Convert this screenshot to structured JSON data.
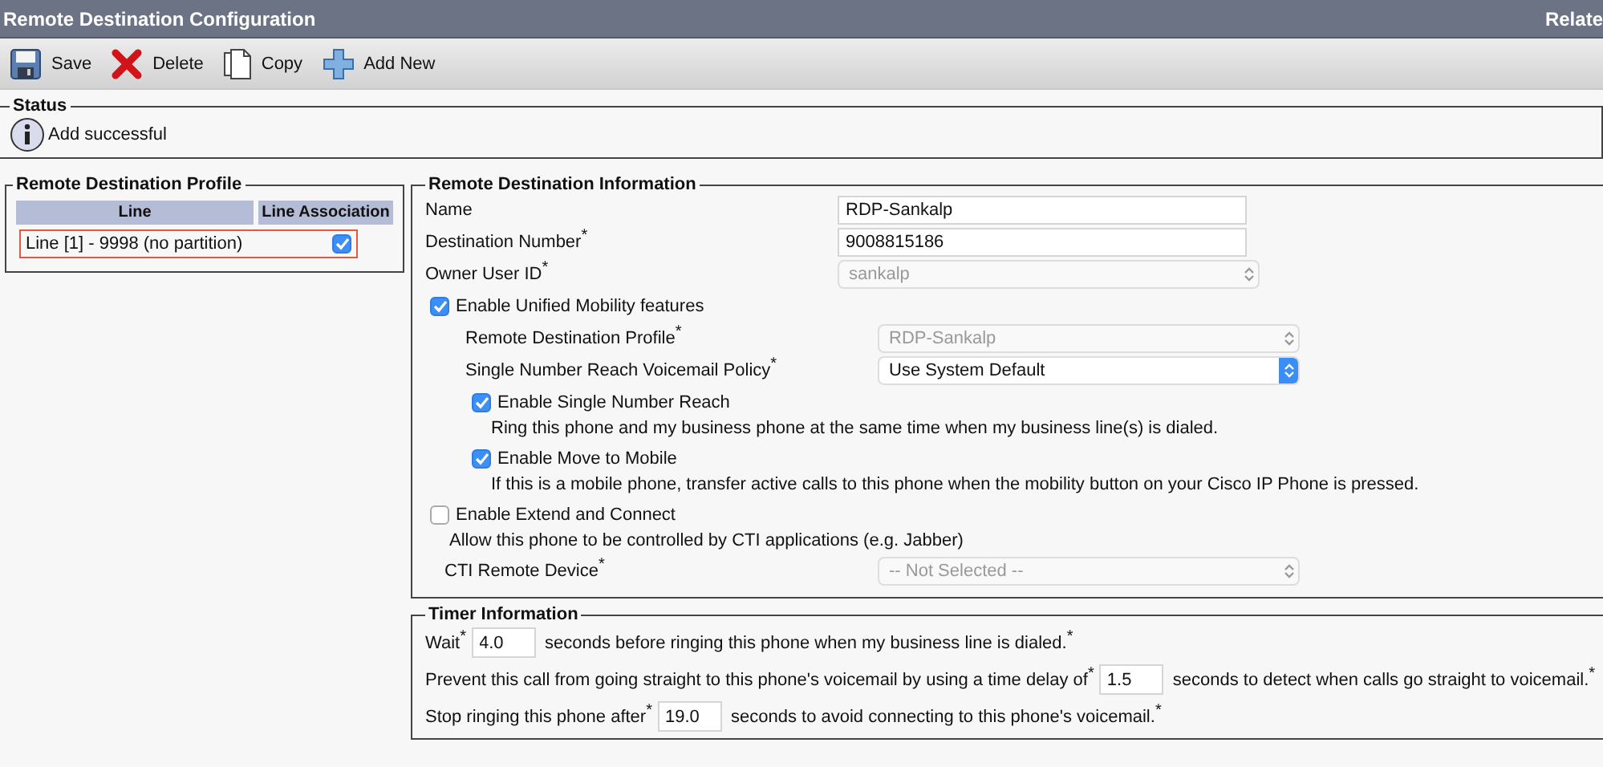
{
  "header": {
    "title": "Remote Destination Configuration",
    "related": "Relate"
  },
  "toolbar": [
    {
      "kind": "save",
      "label": "Save"
    },
    {
      "kind": "delete",
      "label": "Delete"
    },
    {
      "kind": "copy",
      "label": "Copy"
    },
    {
      "kind": "add",
      "label": "Add New"
    }
  ],
  "status": {
    "legend": "Status",
    "message": "Add successful"
  },
  "profile": {
    "legend": "Remote Destination Profile",
    "columns": [
      "Line",
      "Line Association"
    ],
    "rows": [
      {
        "line": "Line [1] - 9998 (no partition)",
        "checked": true,
        "highlighted": true
      }
    ]
  },
  "info": {
    "legend": "Remote Destination Information",
    "fields": [
      {
        "kind": "text",
        "label": "Name",
        "value": "RDP-Sankalp"
      },
      {
        "kind": "text",
        "label": "Destination Number",
        "mark": "*",
        "value": "9008815186"
      },
      {
        "kind": "select",
        "label": "Owner User ID",
        "mark": "*",
        "value": "sankalp",
        "disabled": true
      }
    ],
    "mobility": {
      "label": "Enable Unified Mobility features",
      "checked": true,
      "fields": [
        {
          "kind": "select",
          "label": "Remote Destination Profile",
          "mark": "*",
          "value": "RDP-Sankalp",
          "disabled": true
        },
        {
          "kind": "select",
          "label": "Single Number Reach Voicemail Policy",
          "mark": "*",
          "value": "Use System Default",
          "disabled": false
        }
      ],
      "options": [
        {
          "label": "Enable Single Number Reach",
          "checked": true,
          "description": "Ring this phone and my business phone at the same time when my business line(s) is dialed."
        },
        {
          "label": "Enable Move to Mobile",
          "checked": true,
          "description": "If this is a mobile phone, transfer active calls to this phone when the mobility button on your Cisco IP Phone is pressed."
        }
      ]
    },
    "extend": {
      "label": "Enable Extend and Connect",
      "checked": false,
      "description": "Allow this phone to be controlled by CTI applications (e.g. Jabber)",
      "field": {
        "kind": "select",
        "label": "CTI Remote Device",
        "mark": "*",
        "value": "-- Not Selected --",
        "disabled": true
      }
    }
  },
  "timer": {
    "legend": "Timer Information",
    "rows": [
      {
        "before": "Wait",
        "before_mark": "*",
        "value": "4.0",
        "after": "seconds before ringing this phone when my business line is dialed.",
        "after_mark": "*"
      },
      {
        "before": "Prevent this call from going straight to this phone's voicemail by using a time delay of",
        "before_mark": "*",
        "value": "1.5",
        "after": "seconds to detect when calls go straight to voicemail.",
        "after_mark": "*"
      },
      {
        "before": "Stop ringing this phone after",
        "before_mark": "*",
        "value": "19.0",
        "after": "seconds to avoid connecting to this phone's voicemail.",
        "after_mark": "*"
      }
    ]
  }
}
